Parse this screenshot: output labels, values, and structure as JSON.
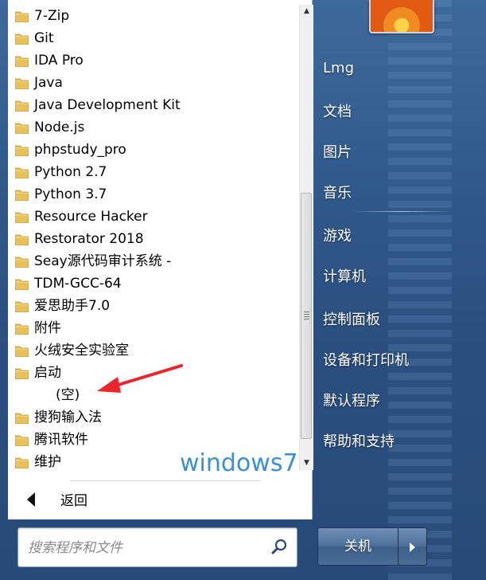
{
  "programs": [
    {
      "label": "7-Zip"
    },
    {
      "label": "Git"
    },
    {
      "label": "IDA Pro"
    },
    {
      "label": "Java"
    },
    {
      "label": "Java Development Kit"
    },
    {
      "label": "Node.js"
    },
    {
      "label": "phpstudy_pro"
    },
    {
      "label": "Python 2.7"
    },
    {
      "label": "Python 3.7"
    },
    {
      "label": "Resource Hacker"
    },
    {
      "label": "Restorator 2018"
    },
    {
      "label": "Seay源代码审计系统 -"
    },
    {
      "label": "TDM-GCC-64"
    },
    {
      "label": "爱思助手7.0"
    },
    {
      "label": "附件"
    },
    {
      "label": "火绒安全实验室"
    },
    {
      "label": "启动"
    },
    {
      "label": "(空)"
    },
    {
      "label": "搜狗输入法"
    },
    {
      "label": "腾讯软件"
    },
    {
      "label": "维护"
    }
  ],
  "back_label": "返回",
  "watermark": "windows7",
  "search": {
    "placeholder": "搜索程序和文件"
  },
  "right_items": [
    {
      "label": "Lmg"
    },
    {
      "label": "文档"
    },
    {
      "label": "图片"
    },
    {
      "label": "音乐"
    },
    {
      "label": "游戏"
    },
    {
      "label": "计算机"
    },
    {
      "label": "控制面板"
    },
    {
      "label": "设备和打印机"
    },
    {
      "label": "默认程序"
    },
    {
      "label": "帮助和支持"
    }
  ],
  "shutdown_label": "关机",
  "colors": {
    "folder": "#e8c15a",
    "watermark": "#3a8fd8",
    "annotation_arrow": "#e8262c",
    "glass": "#2f5888"
  },
  "icons": {
    "folder": "folder-icon",
    "search": "search-icon",
    "back": "back-arrow-icon",
    "shutdown_more": "chevron-right-icon"
  }
}
